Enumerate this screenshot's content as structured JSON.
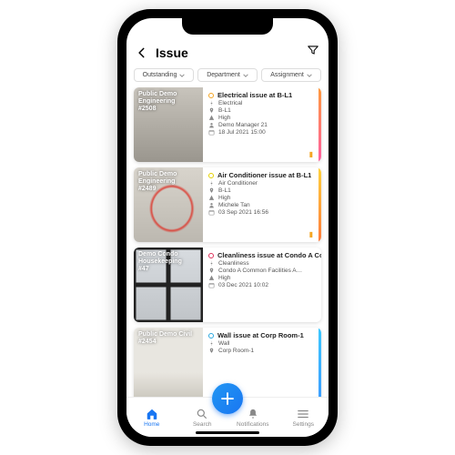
{
  "header": {
    "title": "Issue"
  },
  "filters": {
    "outstanding": "Outstanding",
    "department": "Department",
    "assignment": "Assignment"
  },
  "issues": [
    {
      "project": "Public Demo Engineering",
      "ref": "#2508",
      "title": "Electrical issue at B-L1",
      "category": "Electrical",
      "location": "B-L1",
      "priority": "High",
      "assignee": "Demo Manager 21",
      "date": "18 Jul 2021 15:00",
      "dot_color": "#f5a623",
      "stripe": "linear-gradient(180deg,#ff9a3c,#ff5fa2)"
    },
    {
      "project": "Public Demo Engineering",
      "ref": "#2489",
      "title": "Air Conditioner issue at B-L1",
      "category": "Air Conditioner",
      "location": "B-L1",
      "priority": "High",
      "assignee": "Michele Tan",
      "date": "03 Sep 2021 16:56",
      "dot_color": "#e6d200",
      "stripe": "linear-gradient(180deg,#ffd23c,#ff7a3c)"
    },
    {
      "project": "Demo Condo Housekeeping",
      "ref": "#47",
      "title": "Cleanliness issue at Condo A Common Facilities Are",
      "category": "Cleanliness",
      "location": "Condo A Common Facilities A…",
      "priority": "High",
      "assignee": "",
      "date": "03 Dec 2021 10:02",
      "dot_color": "#e0315b",
      "stripe": "linear-gradient(180deg,#8a4bd8,#5a7bf0)"
    },
    {
      "project": "Public Demo Civil",
      "ref": "#2454",
      "title": "Wall issue at Corp Room-1",
      "category": "Wall",
      "location": "Corp Room-1",
      "priority": "",
      "assignee": "",
      "date": "",
      "dot_color": "#2aa8e0",
      "stripe": "linear-gradient(180deg,#3cc8ff,#3c9cff)"
    }
  ],
  "tabs": {
    "home": "Home",
    "search": "Search",
    "notifications": "Notifications",
    "settings": "Settings"
  }
}
